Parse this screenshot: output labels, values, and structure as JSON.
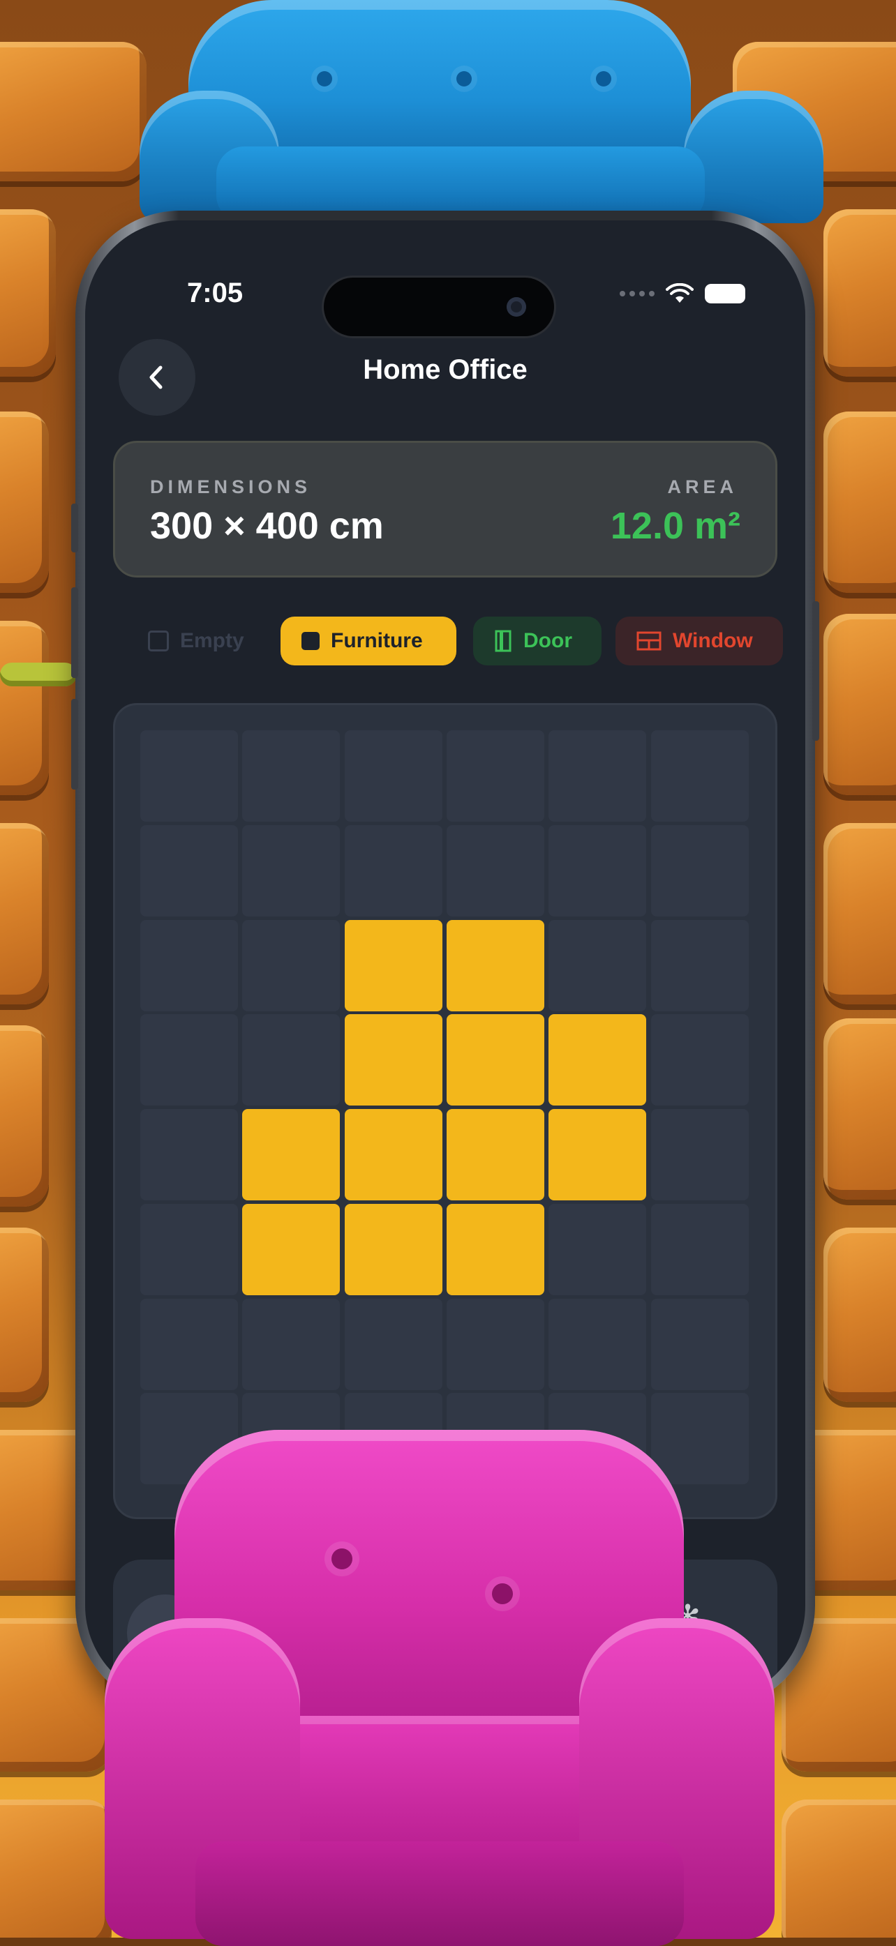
{
  "status": {
    "time": "7:05"
  },
  "header": {
    "title": "Home Office",
    "back_icon": "chevron-left-icon"
  },
  "dimensions": {
    "label": "DIMENSIONS",
    "value": "300 × 400 cm",
    "area_label": "AREA",
    "area_value": "12.0 m²",
    "area_color": "#3cc258"
  },
  "tools": [
    {
      "id": "empty",
      "label": "Empty",
      "icon": "empty-square-icon"
    },
    {
      "id": "furniture",
      "label": "Furniture",
      "icon": "filled-square-icon",
      "selected": true,
      "color": "#f3b71b"
    },
    {
      "id": "door",
      "label": "Door",
      "icon": "door-icon",
      "color": "#3cc258"
    },
    {
      "id": "window",
      "label": "Window",
      "icon": "window-icon",
      "color": "#e2462e"
    }
  ],
  "grid": {
    "columns": 6,
    "rows": 8,
    "cells": [
      [
        "empty",
        "empty",
        "empty",
        "empty",
        "empty",
        "empty"
      ],
      [
        "empty",
        "empty",
        "empty",
        "empty",
        "empty",
        "empty"
      ],
      [
        "empty",
        "empty",
        "furniture",
        "furniture",
        "empty",
        "empty"
      ],
      [
        "empty",
        "empty",
        "furniture",
        "furniture",
        "furniture",
        "empty"
      ],
      [
        "empty",
        "furniture",
        "furniture",
        "furniture",
        "furniture",
        "empty"
      ],
      [
        "empty",
        "furniture",
        "furniture",
        "furniture",
        "empty",
        "empty"
      ],
      [
        "empty",
        "empty",
        "empty",
        "empty",
        "empty",
        "empty"
      ],
      [
        "empty",
        "empty",
        "empty",
        "empty",
        "empty",
        "empty"
      ]
    ]
  }
}
